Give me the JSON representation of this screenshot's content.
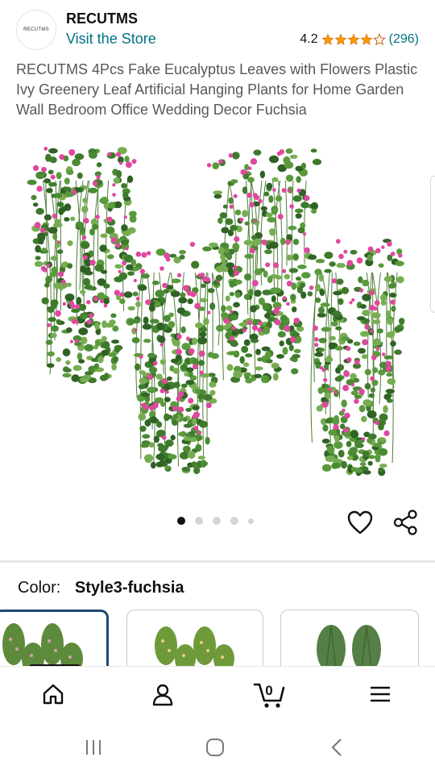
{
  "brand": {
    "logo_text": "RECUTMS",
    "name": "RECUTMS",
    "store_link": "Visit the Store"
  },
  "rating": {
    "value": "4.2",
    "stars": 4.2,
    "count": "(296)"
  },
  "product": {
    "title": "RECUTMS 4Pcs Fake Eucalyptus Leaves with Flowers Plastic Ivy Greenery Leaf Artificial Hanging Plants for Home Garden Wall Bedroom Office Wedding Decor Fuchsia"
  },
  "gallery": {
    "dots": 5,
    "active_index": 0
  },
  "actions": {
    "wishlist_icon": "heart-icon",
    "share_icon": "share-icon"
  },
  "color": {
    "label": "Color:",
    "selected": "Style3-fuchsia",
    "swatches": [
      "Style3-fuchsia",
      "yellow-flowers",
      "green-ferns"
    ]
  },
  "tabbar": {
    "home_icon": "home-icon",
    "account_icon": "account-icon",
    "cart_icon": "cart-icon",
    "cart_count": "0",
    "menu_icon": "menu-icon"
  },
  "system_nav": [
    "recents-icon",
    "home-circle-icon",
    "back-icon"
  ],
  "colors": {
    "link": "#007185",
    "star": "#ff9900",
    "selected_border": "#1d4a73",
    "flower_pink": "#e0479e",
    "leaf_green": "#3e7a2c"
  }
}
